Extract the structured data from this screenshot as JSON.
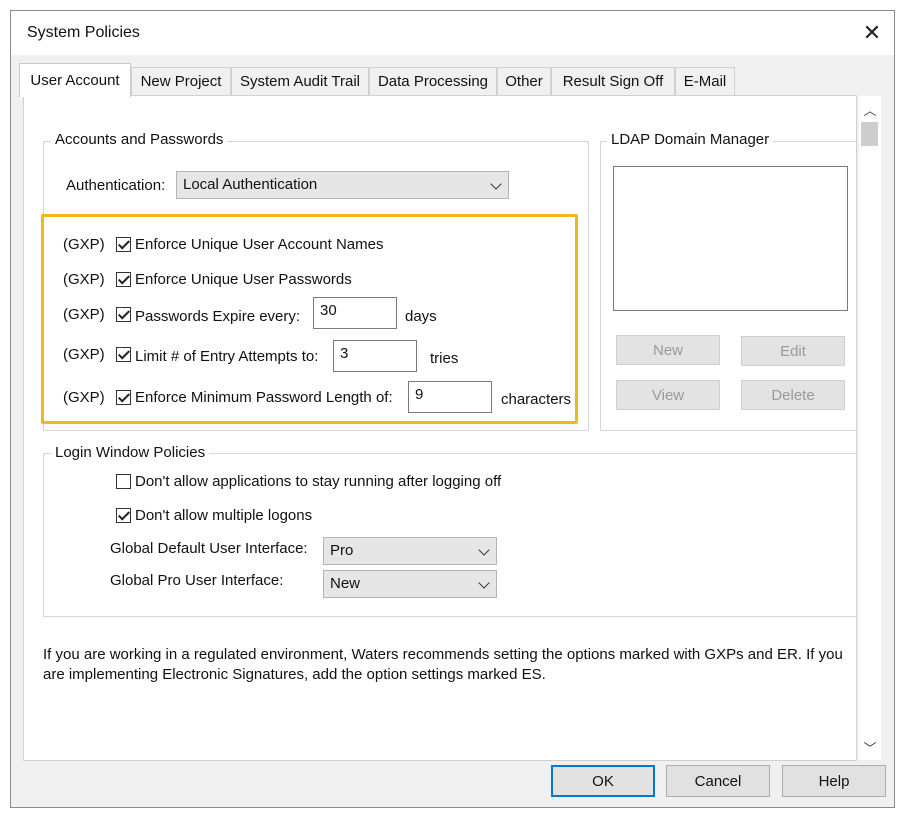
{
  "window": {
    "title": "System Policies",
    "close_icon": "close-icon"
  },
  "tabs": [
    "User Account",
    "New Project",
    "System Audit Trail",
    "Data Processing",
    "Other",
    "Result Sign Off",
    "E-Mail"
  ],
  "active_tab": "User Account",
  "accounts": {
    "group_label": "Accounts and Passwords",
    "auth_label": "Authentication:",
    "auth_value": "Local Authentication",
    "options": [
      {
        "tag": "(GXP)",
        "label": "Enforce Unique User Account Names",
        "checked": true
      },
      {
        "tag": "(GXP)",
        "label": "Enforce Unique User Passwords",
        "checked": true
      },
      {
        "tag": "(GXP)",
        "label": "Passwords Expire every:",
        "checked": true,
        "value": "30",
        "unit": "days"
      },
      {
        "tag": "(GXP)",
        "label": "Limit # of Entry Attempts to:",
        "checked": true,
        "value": "3",
        "unit": "tries"
      },
      {
        "tag": "(GXP)",
        "label": "Enforce Minimum Password Length of:",
        "checked": true,
        "value": "9",
        "unit": "characters"
      }
    ]
  },
  "ldap": {
    "group_label": "LDAP Domain Manager",
    "buttons": {
      "new": "New",
      "edit": "Edit",
      "view": "View",
      "delete": "Delete"
    }
  },
  "login": {
    "group_label": "Login Window Policies",
    "opt1": {
      "label": "Don't allow applications to stay running after logging off",
      "checked": false
    },
    "opt2": {
      "label": "Don't allow multiple logons",
      "checked": true
    },
    "global_default_label": "Global Default User Interface:",
    "global_default_value": "Pro",
    "global_pro_label": "Global Pro User Interface:",
    "global_pro_value": "New"
  },
  "note_line1": "If you are working in a regulated environment, Waters recommends setting the options marked with GXPs and ER.  If you",
  "note_line2": "are implementing Electronic Signatures, add the option settings marked ES.",
  "footer": {
    "ok": "OK",
    "cancel": "Cancel",
    "help": "Help"
  },
  "colors": {
    "highlight": "#f1b71b",
    "focus": "#0078d7"
  }
}
